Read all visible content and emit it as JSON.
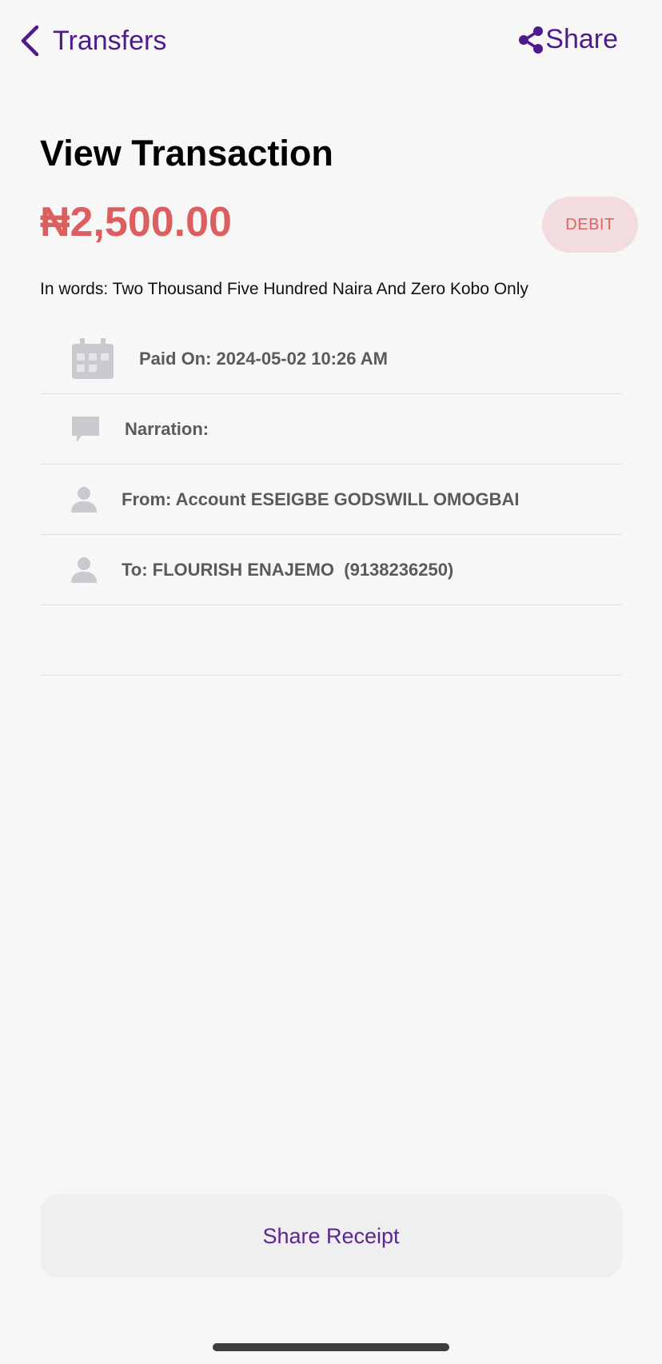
{
  "nav": {
    "back_label": "Transfers",
    "share_label": "Share"
  },
  "title": "View Transaction",
  "amount": "₦2,500.00",
  "type_badge": "DEBIT",
  "in_words": "In words: Two Thousand Five Hundred Naira And Zero Kobo Only",
  "details": [
    {
      "icon": "calendar-icon",
      "text": "Paid On: 2024-05-02 10:26 AM"
    },
    {
      "icon": "chat-bubble-icon",
      "text": "Narration: "
    },
    {
      "icon": "person-icon",
      "text": "From: Account ESEIGBE GODSWILL OMOGBAI"
    },
    {
      "icon": "person-icon",
      "text": "To: FLOURISH ENAJEMO  (9138236250)"
    }
  ],
  "share_receipt_label": "Share Receipt",
  "colors": {
    "brand_purple": "#4e1a8c",
    "debit_red": "#dc5f5f",
    "badge_bg": "#f2dcdd",
    "icon_gray": "#c8cacf"
  }
}
